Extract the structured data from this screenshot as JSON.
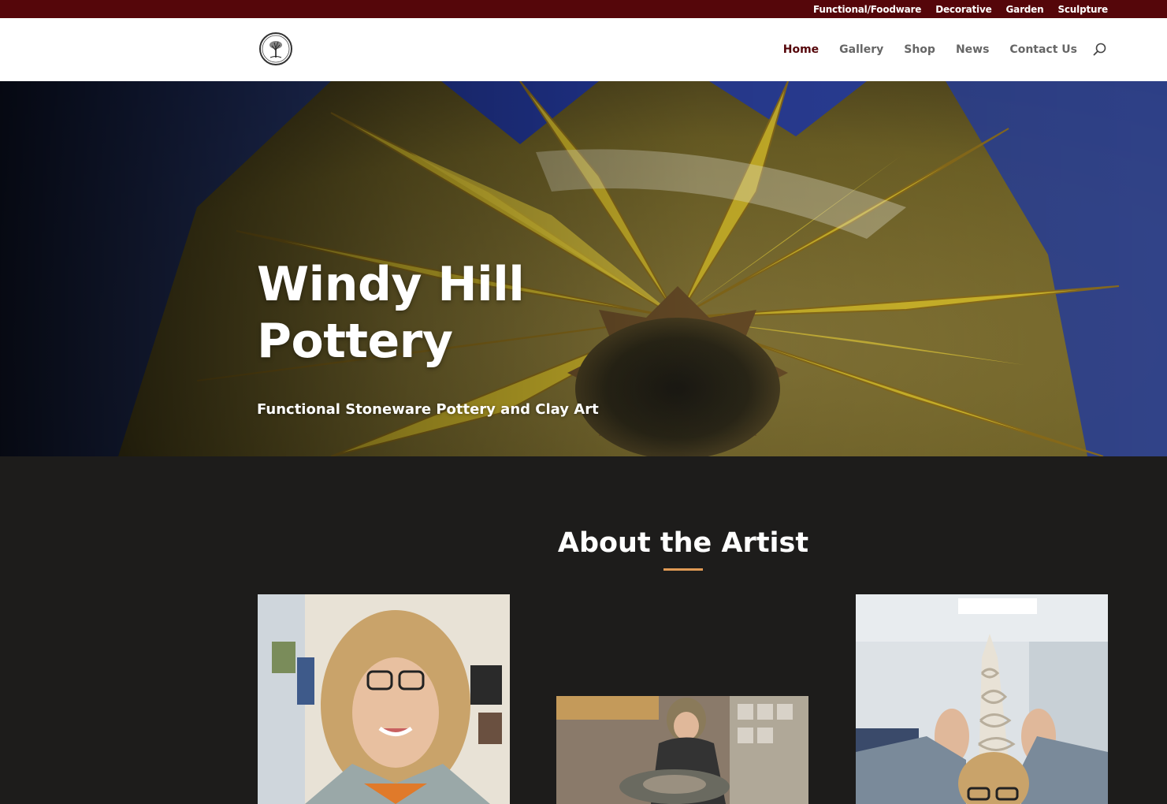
{
  "topbar": {
    "links": [
      "Functional/Foodware",
      "Decorative",
      "Garden",
      "Sculpture"
    ]
  },
  "header": {
    "nav": [
      "Home",
      "Gallery",
      "Shop",
      "News",
      "Contact Us"
    ],
    "active": "Home"
  },
  "hero": {
    "title": "Windy Hill Pottery",
    "subtitle": "Functional Stoneware Pottery and Clay Art"
  },
  "about": {
    "title": "About the Artist"
  },
  "colors": {
    "topbar_bg": "#55060a",
    "accent_underline": "#e09a55",
    "section_bg": "#1d1c1b",
    "nav_text": "#666666"
  },
  "icons": {
    "search": "search-icon",
    "logo": "tree-logo-icon"
  }
}
